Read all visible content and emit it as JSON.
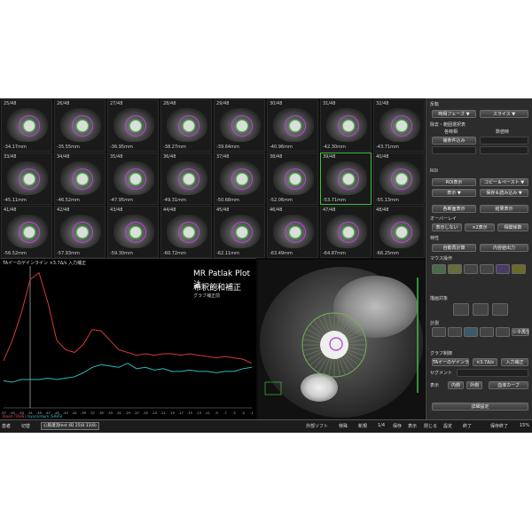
{
  "grid": {
    "cells": [
      {
        "num": "25/48",
        "val": "-34.17mm"
      },
      {
        "num": "26/48",
        "val": "-35.55mm"
      },
      {
        "num": "27/48",
        "val": "-36.95mm"
      },
      {
        "num": "28/48",
        "val": "-38.27mm"
      },
      {
        "num": "29/48",
        "val": "-39.64mm"
      },
      {
        "num": "30/48",
        "val": "-40.96mm"
      },
      {
        "num": "31/48",
        "val": "-42.30mm"
      },
      {
        "num": "32/48",
        "val": "-43.71mm"
      },
      {
        "num": "33/48",
        "val": "-45.11mm"
      },
      {
        "num": "34/48",
        "val": "-46.52mm"
      },
      {
        "num": "35/48",
        "val": "-47.95mm"
      },
      {
        "num": "36/48",
        "val": "-49.31mm"
      },
      {
        "num": "37/48",
        "val": "-50.68mm"
      },
      {
        "num": "38/48",
        "val": "-52.06mm"
      },
      {
        "num": "39/48",
        "val": "-53.71mm"
      },
      {
        "num": "40/48",
        "val": "-55.13mm"
      },
      {
        "num": "41/48",
        "val": "-56.52mm"
      },
      {
        "num": "42/48",
        "val": "-57.93mm"
      },
      {
        "num": "43/48",
        "val": "-59.30mm"
      },
      {
        "num": "44/48",
        "val": "-60.72mm"
      },
      {
        "num": "45/48",
        "val": "-62.11mm"
      },
      {
        "num": "46/48",
        "val": "-63.49mm"
      },
      {
        "num": "47/48",
        "val": "-64.87mm"
      },
      {
        "num": "48/48",
        "val": "-66.25mm"
      }
    ]
  },
  "chart": {
    "header": "TAイーのゲインライン ×3.7Δ/s 入力補正",
    "title": "MR Patlak Plot法",
    "subtitle": "希釈飽和補正",
    "note": "グラフ補正前",
    "legend1": "blood (TAHS)",
    "legend2": "myocardium (SAHS)",
    "colors": {
      "series1": "#d23a3a",
      "series2": "#2fb8c0",
      "cursor": "#ffffff"
    }
  },
  "chart_data": {
    "type": "line",
    "title": "MR Patlak Plot法",
    "subtitle": "希釈飽和補正",
    "x": [
      -57,
      -55,
      -53,
      -51,
      -49,
      -47,
      -45,
      -43,
      -41,
      -39,
      -37,
      -35,
      -33,
      -31,
      -29,
      -27,
      -25,
      -23,
      -21,
      -19,
      -17,
      -15,
      -13,
      -11,
      -9,
      -7,
      -5,
      -3,
      -1
    ],
    "series": [
      {
        "name": "blood (TAHS)",
        "values": [
          0.35,
          0.5,
          0.7,
          0.95,
          1.0,
          0.78,
          0.5,
          0.43,
          0.41,
          0.47,
          0.58,
          0.57,
          0.5,
          0.43,
          0.41,
          0.39,
          0.4,
          0.39,
          0.4,
          0.4,
          0.39,
          0.4,
          0.39,
          0.38,
          0.37,
          0.38,
          0.37,
          0.36,
          0.33
        ]
      },
      {
        "name": "myocardium (SAHS)",
        "values": [
          0.2,
          0.19,
          0.21,
          0.21,
          0.21,
          0.22,
          0.21,
          0.22,
          0.23,
          0.26,
          0.3,
          0.32,
          0.31,
          0.3,
          0.33,
          0.29,
          0.3,
          0.28,
          0.29,
          0.27,
          0.27,
          0.28,
          0.27,
          0.27,
          0.26,
          0.27,
          0.27,
          0.29,
          0.3
        ]
      }
    ],
    "cursor_x": -51,
    "xlabel": "",
    "ylabel": "",
    "ylim": [
      0,
      1.05
    ]
  },
  "right_panel": {
    "s1": "反転",
    "b1a": "時相フェーズ ▼",
    "b1b": "スライス ▼",
    "s2": "除去・範囲選択表",
    "lbl_a": "各時相",
    "lbl_b": "数値時",
    "b2a": "補条件込み",
    "b2b": "",
    "b2c": "",
    "b2d": "",
    "s3": "ROI",
    "b3a": "ROI表示",
    "b3b": "コピー＆ペースト ▼",
    "b3c": "表示 ▼",
    "b3d": "保存＆読み込み ▼",
    "b4a": "各断面表示",
    "b4b": "結果表示",
    "s5": "オーバーレイ",
    "b5a": "表示しない",
    "b5b": "×2表示",
    "b5c": "相関係数",
    "s6": "特性",
    "b6a": "自動再計算",
    "b6b": "内容値出力",
    "s7": "マウス操作",
    "s8": "描画対象",
    "s9": "計測",
    "b9": "シネ再生 ▼",
    "s10": "グラフ制御",
    "b10a": "TAイーのゲインライン",
    "b10b": "×3.7Δ/s",
    "b10c": "入力補正",
    "lbl11": "セグメント",
    "lbl12a": "表示",
    "lbl12b": "内側",
    "lbl12c": "外側",
    "b12": "血液カーブ",
    "b13": "詳細設定"
  },
  "taskbar": {
    "t1": "患者",
    "t2": "切替",
    "box1": "心筋灌流test 4D 25(8 33(8)",
    "t3": "外部ソフト",
    "t4": "特殊",
    "t5": "新規",
    "t6": "1/4",
    "t7": "保存",
    "t8": "表示",
    "t9": "閉じる",
    "t10": "設定",
    "t11": "終了",
    "t12": "保存終了",
    "t13": "15%"
  }
}
